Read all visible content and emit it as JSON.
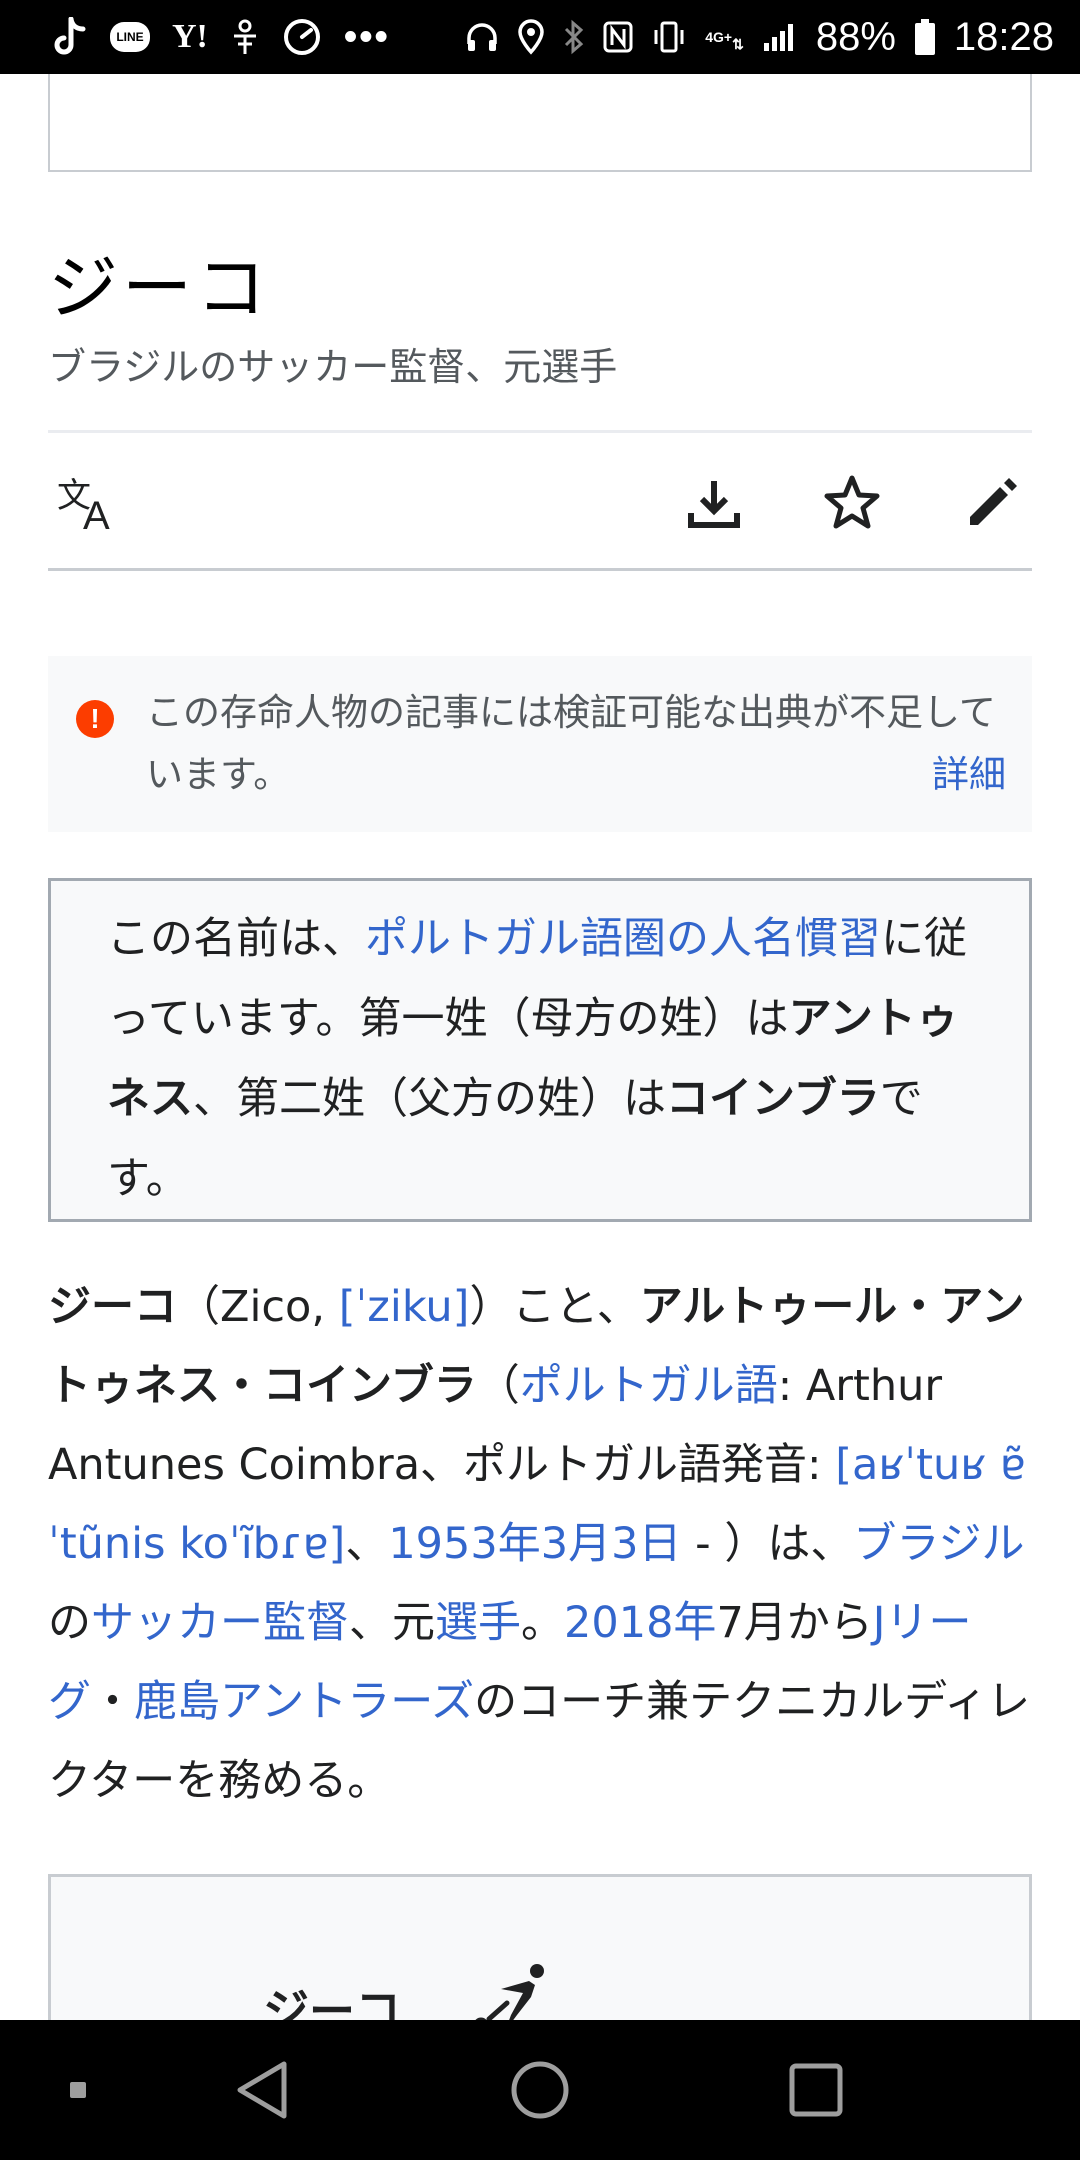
{
  "status_bar": {
    "battery_percent": "88%",
    "time": "18:28",
    "network_badge": "4G+",
    "left_icons": [
      "tiktok-icon",
      "line-icon",
      "yahoo-icon",
      "app-icon",
      "speedometer-icon",
      "more-dots-icon"
    ],
    "line_label": "LINE",
    "yahoo_label": "Y!",
    "dots_label": "•••",
    "right_icons": [
      "headphones-icon",
      "location-icon",
      "bluetooth-icon",
      "nfc-icon",
      "vibrate-icon",
      "signal-icon",
      "battery-icon"
    ]
  },
  "article": {
    "title": "ジーコ",
    "subtitle": "ブラジルのサッカー監督、元選手",
    "toolbar_icons": [
      "translate-icon",
      "download-icon",
      "star-icon",
      "edit-icon"
    ]
  },
  "notice": {
    "icon_glyph": "!",
    "text": "この存命人物の記事には検証可能な出典が不足しています。",
    "link": "詳細"
  },
  "hatnote": {
    "p1": "この名前は、",
    "link1": "ポルトガル語圏の人名慣習",
    "p2": "に従っています。第一姓（母方の姓）は",
    "b1": "アントゥネス",
    "p3": "、第二姓（父方の姓）は",
    "b2": "コインブラ",
    "p4": "です。"
  },
  "lead": {
    "b_name": "ジーコ",
    "t1": "（Zico, ",
    "l_ipa": "[ˈziku]",
    "t2": "）こと、",
    "b_full": "アルトゥール・アントゥネス・コインブラ",
    "t3": "（",
    "l_lang": "ポルトガル語",
    "t4": ": Arthur Antunes Coimbra、ポルトガル語発音: ",
    "l_ipa2": "[aʁˈtuʁ ɐ̃ˈtũnis koˈĩbɾɐ]",
    "t5": "、",
    "l_date": "1953年3月3日",
    "t6": " - ）は、",
    "l_brazil": "ブラジル",
    "t7": " の",
    "l_coach": "サッカー監督",
    "t8": "、元",
    "l_player": "選手",
    "t9": "。",
    "l_year": "2018年",
    "t10": "7月から",
    "l_jleague": "Jリーグ",
    "t11": "・",
    "l_kashima": "鹿島アントラーズ",
    "t12": "のコーチ兼テクニカルディレクターを務める。"
  },
  "infobox": {
    "title": "ジーコ",
    "icon": "football-player-icon"
  },
  "nav_bar": {
    "buttons": [
      "recents-dot-icon",
      "back-icon",
      "home-icon",
      "overview-icon"
    ]
  }
}
